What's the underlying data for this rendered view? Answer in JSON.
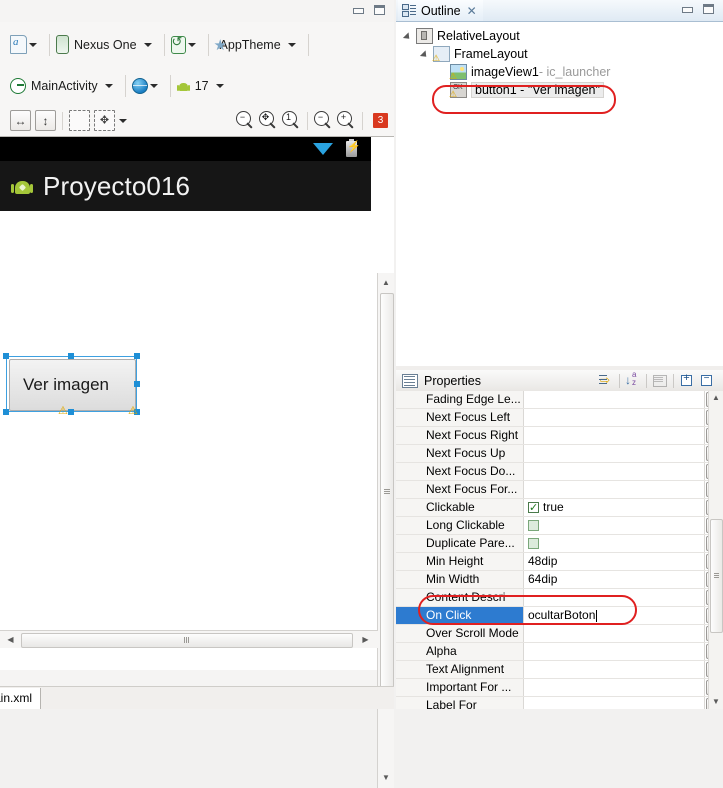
{
  "editor": {
    "toolbar_row1": [
      {
        "name": "layout-config",
        "icon": "layout-file-icon",
        "label": ""
      },
      {
        "name": "device",
        "icon": "device-icon",
        "label": "Nexus One"
      },
      {
        "name": "orientation",
        "icon": "rotate-icon",
        "label": ""
      },
      {
        "name": "theme",
        "icon": "star-icon",
        "label": "AppTheme"
      }
    ],
    "toolbar_row2": [
      {
        "name": "activity",
        "icon": "activity-icon",
        "label": "MainActivity"
      },
      {
        "name": "locale",
        "icon": "globe-icon",
        "label": ""
      },
      {
        "name": "api-level",
        "icon": "android-icon",
        "label": "17"
      }
    ],
    "toolbar_row3": {
      "fit_width": "fit-width-icon",
      "fit_height": "fit-height-icon",
      "show_outline": "show-outline-icon",
      "distribute": "distribute-icon",
      "zoom_out_fit": "zoom-out-fit-icon",
      "zoom_fit": "zoom-fit-icon",
      "zoom_100": "zoom-100-icon",
      "zoom_out": "zoom-out-icon",
      "zoom_in": "zoom-in-icon",
      "badge_count": "3"
    },
    "preview": {
      "app_title": "Proyecto016",
      "button_label": "Ver imagen",
      "app_icon": "android-launcher-icon",
      "status_wifi": "wifi-icon",
      "status_battery": "battery-icon"
    },
    "bottom_tab": "ain.xml"
  },
  "outline": {
    "tab_title": "Outline",
    "close": "✕",
    "tree": [
      {
        "name": "RelativeLayout",
        "icon": "relative-layout-icon",
        "indent": 0,
        "warn": false,
        "sub": ""
      },
      {
        "name": "FrameLayout",
        "icon": "frame-layout-icon",
        "indent": 1,
        "warn": true,
        "sub": ""
      },
      {
        "name": "imageView1",
        "icon": "image-view-icon",
        "indent": 2,
        "warn": true,
        "sub": " - ic_launcher"
      },
      {
        "name": "button1 - \"Ver imagen\"",
        "icon": "button-icon",
        "indent": 2,
        "warn": true,
        "sub": ""
      }
    ],
    "highlight_color": "#e02020"
  },
  "properties": {
    "title": "Properties",
    "tools": [
      {
        "name": "show-advanced-button",
        "icon": "advanced-icon"
      },
      {
        "name": "sort-alphabetically-button",
        "icon": "sort-az-icon"
      },
      {
        "name": "filter-button",
        "icon": "filter-icon"
      },
      {
        "name": "expand-all-button",
        "icon": "expand-icon"
      },
      {
        "name": "collapse-all-button",
        "icon": "collapse-icon"
      }
    ],
    "rows": [
      {
        "label": "Fading Edge Le...",
        "value": "",
        "type": "text",
        "selected": false
      },
      {
        "label": "Next Focus Left",
        "value": "",
        "type": "text",
        "selected": false
      },
      {
        "label": "Next Focus Right",
        "value": "",
        "type": "text",
        "selected": false
      },
      {
        "label": "Next Focus Up",
        "value": "",
        "type": "text",
        "selected": false
      },
      {
        "label": "Next Focus Do...",
        "value": "",
        "type": "text",
        "selected": false
      },
      {
        "label": "Next Focus For...",
        "value": "",
        "type": "text",
        "selected": false
      },
      {
        "label": "Clickable",
        "value": "true",
        "type": "checkbox-on",
        "selected": false
      },
      {
        "label": "Long Clickable",
        "value": "",
        "type": "checkbox-off",
        "selected": false
      },
      {
        "label": "Duplicate Pare...",
        "value": "",
        "type": "checkbox-off",
        "selected": false
      },
      {
        "label": "Min Height",
        "value": "48dip",
        "type": "text",
        "selected": false
      },
      {
        "label": "Min Width",
        "value": "64dip",
        "type": "text",
        "selected": false
      },
      {
        "label": "Content Descri",
        "value": "",
        "type": "text",
        "selected": false
      },
      {
        "label": "On Click",
        "value": "ocultarBoton",
        "type": "editing",
        "selected": true
      },
      {
        "label": "Over Scroll Mode",
        "value": "",
        "type": "text",
        "selected": false
      },
      {
        "label": "Alpha",
        "value": "",
        "type": "text",
        "selected": false
      },
      {
        "label": "Text Alignment",
        "value": "",
        "type": "text",
        "selected": false
      },
      {
        "label": "Important For ...",
        "value": "",
        "type": "text",
        "selected": false
      },
      {
        "label": "Label For",
        "value": "",
        "type": "text",
        "selected": false
      }
    ],
    "dots_label": "•••"
  }
}
